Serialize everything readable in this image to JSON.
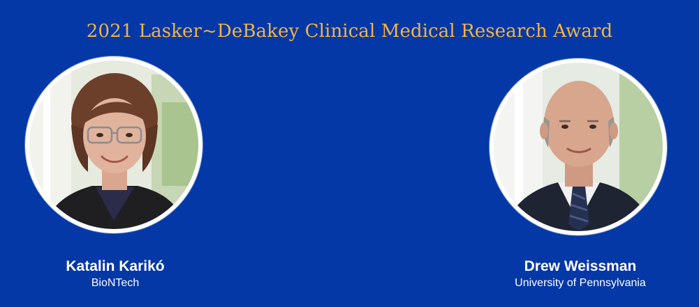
{
  "award": {
    "title": "2021 Lasker~DeBakey Clinical Medical Research Award"
  },
  "winners": [
    {
      "name": "Katalin Karikó",
      "affiliation": "BioNTech"
    },
    {
      "name": "Drew Weissman",
      "affiliation": "University of Pennsylvania"
    }
  ],
  "colors": {
    "background": "#0438a6",
    "title": "#f2b445",
    "text": "#ffffff",
    "ring": "#ffffff"
  }
}
